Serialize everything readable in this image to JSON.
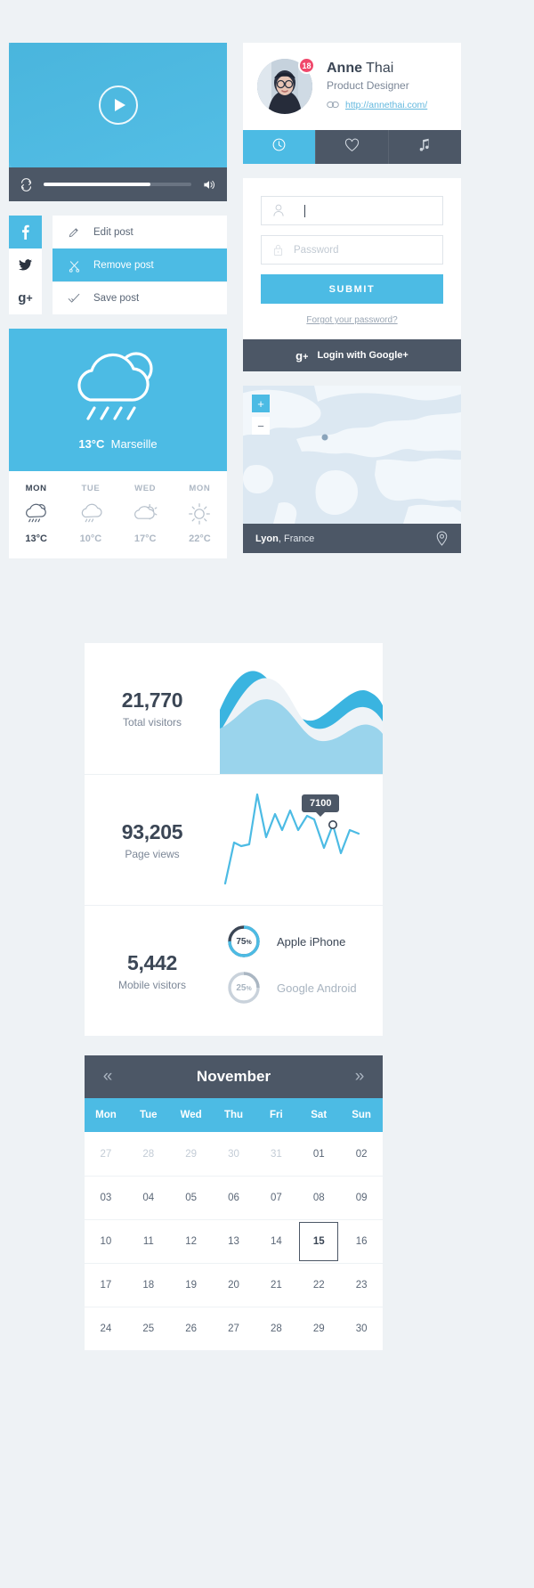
{
  "video": {
    "loop_icon": "loop-icon",
    "volume_icon": "volume-icon",
    "play_icon": "play-icon",
    "progress_percent": 72
  },
  "social": {
    "buttons": [
      {
        "name": "facebook",
        "label": "f",
        "active": true
      },
      {
        "name": "twitter",
        "label": "🐦",
        "active": false
      },
      {
        "name": "googleplus",
        "label": "g+",
        "active": false
      }
    ]
  },
  "post_menu": {
    "items": [
      {
        "label": "Edit post",
        "icon": "pencil-icon",
        "active": false
      },
      {
        "label": "Remove post",
        "icon": "scissors-icon",
        "active": true
      },
      {
        "label": "Save post",
        "icon": "check-icon",
        "active": false
      }
    ]
  },
  "weather": {
    "current_temp": "13°C",
    "city": "Marseille",
    "condition_icon": "cloud-rain-icon",
    "forecast": [
      {
        "day": "MON",
        "temp": "13°C",
        "icon": "cloud-sun-rain-icon",
        "today": true
      },
      {
        "day": "TUE",
        "temp": "10°C",
        "icon": "cloud-rain-icon",
        "today": false
      },
      {
        "day": "WED",
        "temp": "17°C",
        "icon": "cloud-sun-icon",
        "today": false
      },
      {
        "day": "MON",
        "temp": "22°C",
        "icon": "sun-icon",
        "today": false
      }
    ]
  },
  "profile": {
    "badge_count": "18",
    "first_name": "Anne",
    "last_name": "Thai",
    "role": "Product Designer",
    "link_text": "http://annethai.com/",
    "link_icon": "link-icon",
    "tabs": [
      {
        "icon": "clock-icon",
        "name": "tab-history",
        "active": true
      },
      {
        "icon": "heart-icon",
        "name": "tab-likes",
        "active": false
      },
      {
        "icon": "music-icon",
        "name": "tab-music",
        "active": false
      }
    ]
  },
  "login": {
    "username_value": "",
    "username_icon": "user-icon",
    "username_placeholder": "",
    "password_icon": "lock-icon",
    "password_placeholder": "Password",
    "submit_label": "SUBMIT",
    "forgot_label": "Forgot your password?",
    "google_icon": "googleplus-icon",
    "google_label_bold": "Login with Google+"
  },
  "map": {
    "zoom_in": "+",
    "zoom_out": "−",
    "city": "Lyon",
    "country": ", France",
    "pin_icon": "map-pin-icon"
  },
  "stats": [
    {
      "value": "21,770",
      "label": "Total visitors",
      "type": "area"
    },
    {
      "value": "93,205",
      "label": "Page views",
      "type": "line",
      "tooltip": "7100"
    },
    {
      "value": "5,442",
      "label": "Mobile visitors",
      "type": "donuts"
    }
  ],
  "donuts": [
    {
      "pct": "75",
      "unit": "%",
      "label": "Apple iPhone",
      "color": "#4cbbe4",
      "track": "#3b4655",
      "muted": false
    },
    {
      "pct": "25",
      "unit": "%",
      "label": "Google Android",
      "color": "#aab6c2",
      "track": "#c9d2db",
      "muted": true
    }
  ],
  "calendar": {
    "prev_icon": "chevron-left-double-icon",
    "next_icon": "chevron-right-double-icon",
    "month": "November",
    "dow": [
      "Mon",
      "Tue",
      "Wed",
      "Thu",
      "Fri",
      "Sat",
      "Sun"
    ],
    "weeks": [
      [
        {
          "d": "27",
          "out": true
        },
        {
          "d": "28",
          "out": true
        },
        {
          "d": "29",
          "out": true
        },
        {
          "d": "30",
          "out": true
        },
        {
          "d": "31",
          "out": true
        },
        {
          "d": "01",
          "out": false
        },
        {
          "d": "02",
          "out": false
        }
      ],
      [
        {
          "d": "03",
          "out": false
        },
        {
          "d": "04",
          "out": false
        },
        {
          "d": "05",
          "out": false
        },
        {
          "d": "06",
          "out": false
        },
        {
          "d": "07",
          "out": false
        },
        {
          "d": "08",
          "out": false
        },
        {
          "d": "09",
          "out": false
        }
      ],
      [
        {
          "d": "10",
          "out": false
        },
        {
          "d": "11",
          "out": false
        },
        {
          "d": "12",
          "out": false
        },
        {
          "d": "13",
          "out": false
        },
        {
          "d": "14",
          "out": false
        },
        {
          "d": "15",
          "out": false,
          "selected": true
        },
        {
          "d": "16",
          "out": false
        }
      ],
      [
        {
          "d": "17",
          "out": false
        },
        {
          "d": "18",
          "out": false
        },
        {
          "d": "19",
          "out": false
        },
        {
          "d": "20",
          "out": false
        },
        {
          "d": "21",
          "out": false
        },
        {
          "d": "22",
          "out": false
        },
        {
          "d": "23",
          "out": false
        }
      ],
      [
        {
          "d": "24",
          "out": false
        },
        {
          "d": "25",
          "out": false
        },
        {
          "d": "26",
          "out": false
        },
        {
          "d": "27",
          "out": false
        },
        {
          "d": "28",
          "out": false
        },
        {
          "d": "29",
          "out": false
        },
        {
          "d": "30",
          "out": false
        }
      ]
    ]
  },
  "chart_data": [
    {
      "type": "area",
      "title": "Total visitors",
      "total": 21770,
      "x": [
        0,
        1,
        2,
        3,
        4,
        5,
        6,
        7,
        8,
        9,
        10
      ],
      "series": [
        {
          "name": "front-wave",
          "values": [
            10,
            35,
            62,
            55,
            30,
            18,
            22,
            40,
            58,
            50,
            38
          ]
        },
        {
          "name": "back-wave",
          "values": [
            38,
            55,
            45,
            28,
            35,
            55,
            62,
            48,
            30,
            25,
            35
          ]
        }
      ],
      "grid": false,
      "legend": "none"
    },
    {
      "type": "line",
      "title": "Page views",
      "total": 93205,
      "annotation": {
        "label": "7100",
        "x": 13
      },
      "values": [
        2,
        14,
        26,
        24,
        72,
        40,
        62,
        45,
        58,
        40,
        52,
        56,
        28,
        48,
        20,
        44,
        40
      ],
      "grid": false,
      "legend": "none"
    },
    {
      "type": "pie",
      "title": "Mobile visitors",
      "total": 5442,
      "labels": [
        "Apple iPhone",
        "Google Android"
      ],
      "values": [
        75,
        25
      ],
      "unit": "%",
      "legend": "right"
    }
  ],
  "colors": {
    "accent": "#4cbbe4",
    "dark": "#4c5766",
    "bg": "#eef2f5",
    "badge": "#f0486b"
  }
}
